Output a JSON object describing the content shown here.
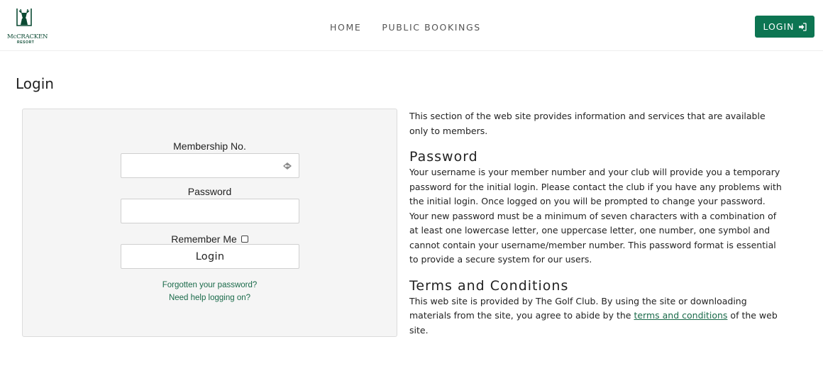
{
  "header": {
    "logo": {
      "name": "McCRACKEN",
      "sub": "RESORT"
    },
    "nav": [
      {
        "label": "HOME"
      },
      {
        "label": "PUBLIC BOOKINGS"
      }
    ],
    "login_label": "LOGIN",
    "accent_color": "#0d7552"
  },
  "page": {
    "title": "Login"
  },
  "login_form": {
    "membership_label": "Membership No.",
    "membership_value": "",
    "password_label": "Password",
    "password_value": "",
    "remember_label": "Remember Me",
    "remember_checked": false,
    "submit_label": "Login",
    "forgot_link": "Forgotten your password?",
    "help_link": "Need help logging on?"
  },
  "info": {
    "intro": "This section of the web site provides information and services that are available only to members.",
    "password_heading": "Password",
    "password_text": "Your username is your member number and your club will provide you a temporary password for the initial login. Please contact the club if you have any problems with the initial login. Once logged on you will be prompted to change your password. Your new password must be a minimum of seven characters with a combination of at least one lowercase letter, one uppercase letter, one number, one symbol and cannot contain your username/member number. This password format is essential to provide a secure system for our users.",
    "terms_heading": "Terms and Conditions",
    "terms_text_before": "This web site is provided by The Golf Club. By using the site or downloading materials from the site, you agree to abide by the ",
    "terms_link": "terms and conditions",
    "terms_text_after": " of the web site."
  }
}
